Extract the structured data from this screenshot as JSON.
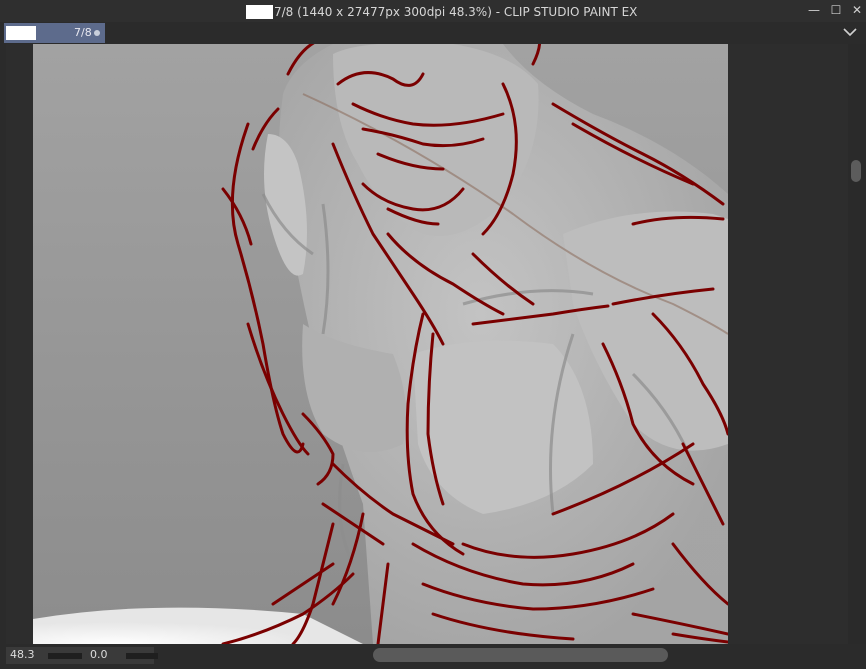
{
  "window": {
    "title": "7/8 (1440 x 27477px 300dpi 48.3%)  - CLIP STUDIO PAINT EX",
    "minimize_glyph": "—",
    "maximize_glyph": "☐",
    "close_glyph": "✕"
  },
  "tab": {
    "label": "7/8",
    "modified_indicator": "●"
  },
  "tab_menu_icon": "chevron-down-icon",
  "statusbar": {
    "zoom": "48.3",
    "rotation": "0.0"
  },
  "colors": {
    "sketch_line": "#7a0000",
    "tab_active": "#5d6b8c",
    "background": "#2b2b2b"
  }
}
